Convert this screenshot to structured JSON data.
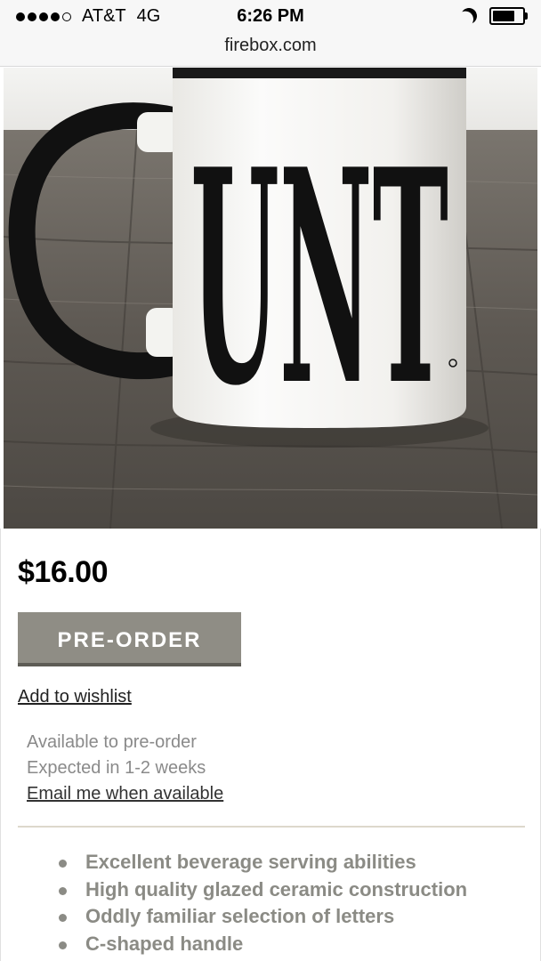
{
  "status_bar": {
    "carrier": "AT&T",
    "network": "4G",
    "time": "6:26 PM",
    "signal_bars": 4,
    "signal_total": 5,
    "dnd_icon": "moon-icon",
    "battery_icon": "battery-icon"
  },
  "browser": {
    "url": "firebox.com"
  },
  "product": {
    "image_mug_text": "UNT",
    "price": "$16.00",
    "preorder_label": "PRE-ORDER",
    "wishlist_label": "Add to wishlist",
    "availability_line1": "Available to pre-order",
    "availability_line2": "Expected in 1-2 weeks",
    "email_link": "Email me when available",
    "features": [
      "Excellent beverage serving abilities",
      "High quality glazed ceramic construction",
      "Oddly familiar selection of letters",
      "C-shaped handle"
    ]
  },
  "colors": {
    "button": "#8f8d85",
    "feature_text": "#8b8b85",
    "availability_text": "#8a8a8a"
  }
}
